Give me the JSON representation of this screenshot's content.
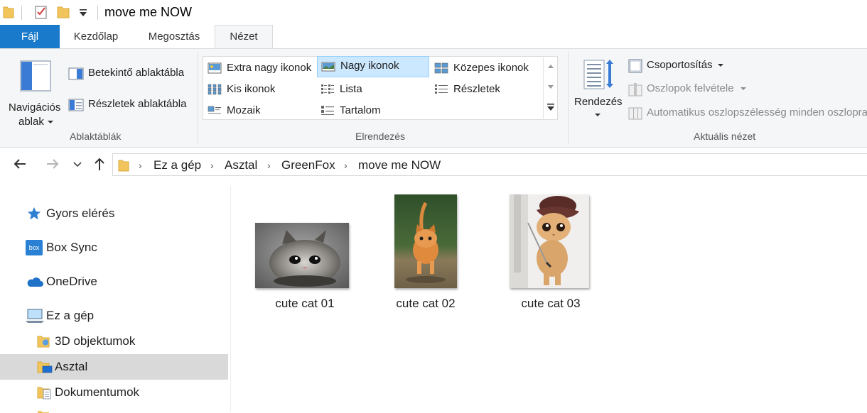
{
  "window": {
    "title": "move me NOW"
  },
  "tabs": [
    {
      "label": "Fájl"
    },
    {
      "label": "Kezdőlap"
    },
    {
      "label": "Megosztás"
    },
    {
      "label": "Nézet"
    }
  ],
  "ribbon": {
    "panes": {
      "nav_pane_line1": "Navigációs",
      "nav_pane_line2": "ablak",
      "preview_pane": "Betekintő ablaktábla",
      "details_pane": "Részletek ablaktábla",
      "group_label": "Ablaktáblák"
    },
    "layout": {
      "items": [
        {
          "label": "Extra nagy ikonok"
        },
        {
          "label": "Nagy ikonok",
          "selected": true
        },
        {
          "label": "Közepes ikonok"
        },
        {
          "label": "Kis ikonok"
        },
        {
          "label": "Lista"
        },
        {
          "label": "Részletek"
        },
        {
          "label": "Mozaik"
        },
        {
          "label": "Tartalom"
        }
      ],
      "group_label": "Elrendezés"
    },
    "current_view": {
      "sort_label": "Rendezés",
      "group_by": "Csoportosítás",
      "add_columns": "Oszlopok felvétele",
      "size_columns": "Automatikus oszlopszélesség minden oszlopra",
      "group_label": "Aktuális nézet"
    }
  },
  "address": {
    "crumbs": [
      "Ez a gép",
      "Asztal",
      "GreenFox",
      "move me NOW"
    ]
  },
  "nav_pane": {
    "items": [
      {
        "label": "Gyors elérés",
        "icon": "star-icon"
      },
      {
        "label": "Box Sync",
        "icon": "box-icon"
      },
      {
        "label": "OneDrive",
        "icon": "cloud-icon"
      },
      {
        "label": "Ez a gép",
        "icon": "computer-icon"
      },
      {
        "label": "3D objektumok",
        "icon": "folder-3d-icon"
      },
      {
        "label": "Asztal",
        "icon": "desktop-folder-icon",
        "selected": true
      },
      {
        "label": "Dokumentumok",
        "icon": "documents-folder-icon"
      }
    ]
  },
  "files": [
    {
      "name": "cute cat 01"
    },
    {
      "name": "cute cat 02"
    },
    {
      "name": "cute cat 03"
    }
  ],
  "colors": {
    "accent": "#1979ca",
    "selection": "#cce8ff",
    "nav_selected": "#d9d9d9"
  }
}
